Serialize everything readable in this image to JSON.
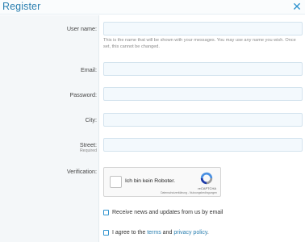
{
  "dialog": {
    "title": "Register",
    "close_icon": "close-icon"
  },
  "fields": {
    "username": {
      "label": "User name:",
      "value": "",
      "hint": "This is the name that will be shown with your messages. You may use any name you wish. Once set, this cannot be changed."
    },
    "email": {
      "label": "Email:",
      "value": ""
    },
    "password": {
      "label": "Password:",
      "value": ""
    },
    "city": {
      "label": "City:",
      "value": ""
    },
    "street": {
      "label": "Street:",
      "sublabel": "Required",
      "value": ""
    }
  },
  "verification": {
    "label": "Verification:",
    "captcha_text": "Ich bin kein Roboter.",
    "brand": "reCAPTCHA",
    "links": "Datenschutzerklärung - Nutzungsbedingungen"
  },
  "options": {
    "news": {
      "text": "Receive news and updates from us by email",
      "checked": false
    },
    "terms": {
      "prefix": "I agree to the",
      "terms_link": "terms",
      "and": "and",
      "privacy_link": "privacy policy",
      "suffix": ".",
      "checked": false
    }
  },
  "colors": {
    "accent": "#2f93cf",
    "title": "#2a7fb0",
    "input_bg": "#f3f9fd",
    "sidebar_bg": "#f4f7f9"
  }
}
